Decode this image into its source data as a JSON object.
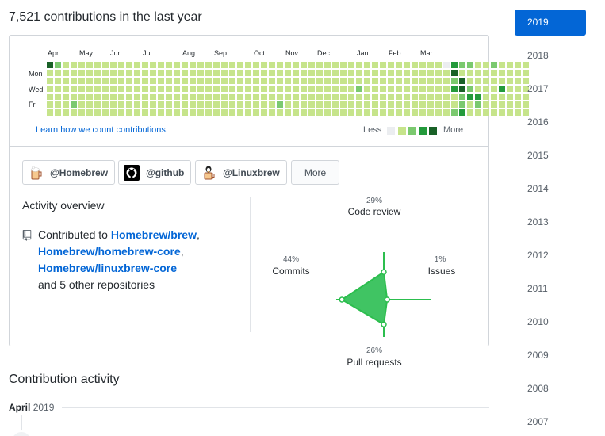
{
  "header": {
    "title": "7,521 contributions in the last year"
  },
  "graph": {
    "months": [
      "Apr",
      "May",
      "Jun",
      "Jul",
      "Aug",
      "Sep",
      "Oct",
      "Nov",
      "Dec",
      "Jan",
      "Feb",
      "Mar"
    ],
    "weekdays": [
      "Mon",
      "Wed",
      "Fri"
    ],
    "learn_link": "Learn how we count contributions.",
    "legend_less": "Less",
    "legend_more": "More",
    "colors": [
      "#ebedf0",
      "#c6e48b",
      "#7bc96f",
      "#239a3b",
      "#196127"
    ],
    "rows": [
      "4211111111111111111111111111111111111111111111111103221121111",
      "1111111111111111111111111111111111111111111111111114111111111",
      "1111111111111111111111111111111111111111111111111112411111111",
      "1111111111111111111111111111111111111112111111111113421113111",
      "1111111111111111111111111111111111111111111111111111233111111",
      "1112111111111111111111111111121111111111111111111111212111111",
      "1111111111111111111111111111111111111111111111111112311111111"
    ]
  },
  "orgs": [
    {
      "label": "@Homebrew",
      "icon": "homebrew-avatar-icon"
    },
    {
      "label": "@github",
      "icon": "github-avatar-icon"
    },
    {
      "label": "@Linuxbrew",
      "icon": "linuxbrew-avatar-icon"
    }
  ],
  "more_button": "More",
  "activity": {
    "title": "Activity overview",
    "contributed_to": "Contributed to",
    "repo1": "Homebrew/brew",
    "repo2": "Homebrew/homebrew-core",
    "repo3": "Homebrew/linuxbrew-core",
    "others": "and 5 other repositories",
    "comma": ","
  },
  "radar": {
    "code_review": {
      "label": "Code review",
      "pct": "29%",
      "value": 29
    },
    "issues": {
      "label": "Issues",
      "pct": "1%",
      "value": 1
    },
    "pull_requests": {
      "label": "Pull requests",
      "pct": "26%",
      "value": 26
    },
    "commits": {
      "label": "Commits",
      "pct": "44%",
      "value": 44
    },
    "fill_color": "#40c463",
    "line_color": "#2cbe4e"
  },
  "contribution_activity": {
    "title": "Contribution activity",
    "month": "April",
    "year": "2019"
  },
  "years": [
    "2019",
    "2018",
    "2017",
    "2016",
    "2015",
    "2014",
    "2013",
    "2012",
    "2011",
    "2010",
    "2009",
    "2008",
    "2007"
  ],
  "selected_year": "2019",
  "accent_color": "#0366d6"
}
